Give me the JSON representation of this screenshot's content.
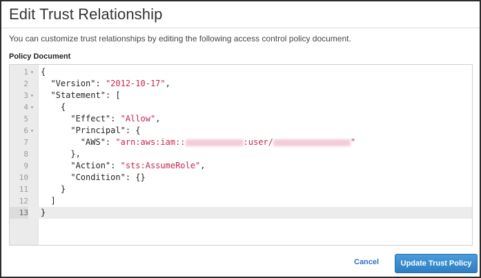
{
  "dialog": {
    "title": "Edit Trust Relationship",
    "description": "You can customize trust relationships by editing the following access control policy document.",
    "policy_label": "Policy Document"
  },
  "editor": {
    "lines": [
      {
        "num": "1",
        "fold": true
      },
      {
        "num": "2",
        "fold": false
      },
      {
        "num": "3",
        "fold": true
      },
      {
        "num": "4",
        "fold": true
      },
      {
        "num": "5",
        "fold": false
      },
      {
        "num": "6",
        "fold": true
      },
      {
        "num": "7",
        "fold": false
      },
      {
        "num": "8",
        "fold": false
      },
      {
        "num": "9",
        "fold": false
      },
      {
        "num": "10",
        "fold": false
      },
      {
        "num": "11",
        "fold": false
      },
      {
        "num": "12",
        "fold": false
      },
      {
        "num": "13",
        "fold": false
      }
    ],
    "tokens": {
      "version_key": "\"Version\"",
      "version_val": "\"2012-10-17\"",
      "statement_key": "\"Statement\"",
      "effect_key": "\"Effect\"",
      "effect_val": "\"Allow\"",
      "principal_key": "\"Principal\"",
      "aws_key": "\"AWS\"",
      "arn_prefix": "\"arn:aws:iam::",
      "arn_mid": ":user/",
      "arn_end": "\"",
      "action_key": "\"Action\"",
      "action_val": "\"sts:AssumeRole\"",
      "condition_key": "\"Condition\""
    }
  },
  "footer": {
    "cancel_label": "Cancel",
    "primary_label": "Update Trust Policy"
  },
  "colors": {
    "string": "#c7254e",
    "primary_button": "#2e7ec2",
    "link": "#2f6fbf"
  }
}
